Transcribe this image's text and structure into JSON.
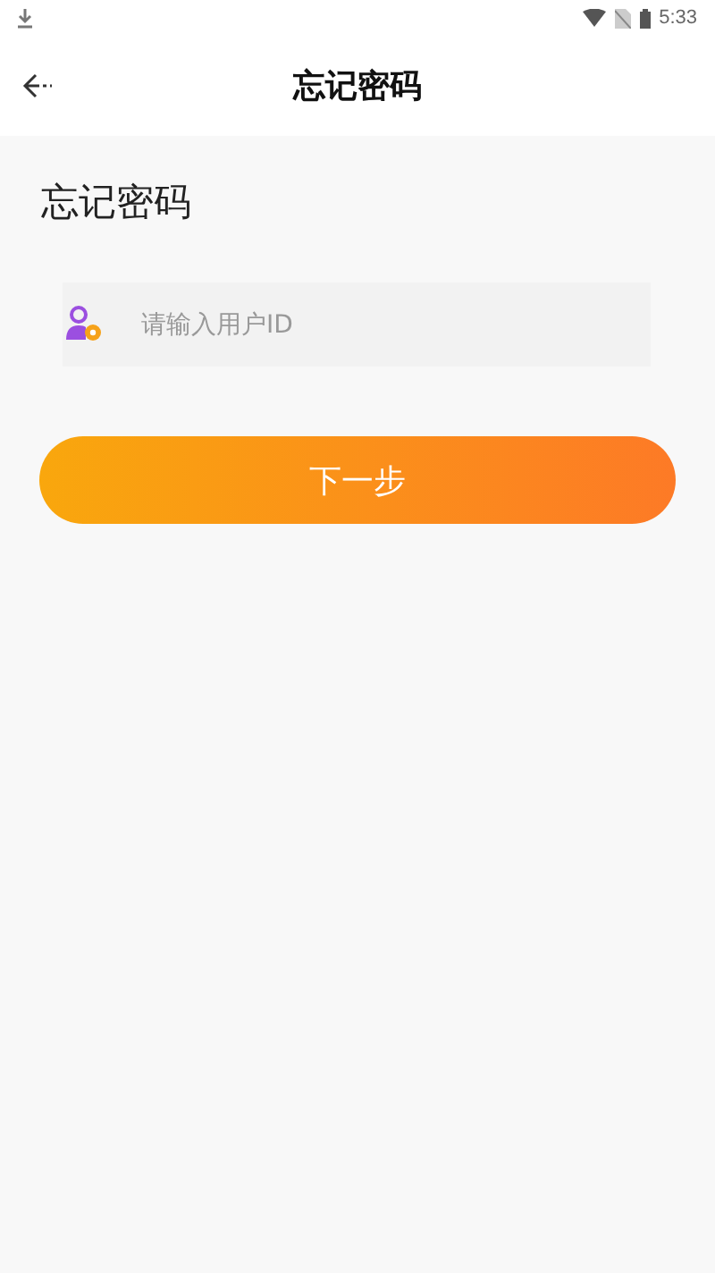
{
  "status_bar": {
    "time": "5:33"
  },
  "header": {
    "title": "忘记密码"
  },
  "heading": "忘记密码",
  "user_id_field": {
    "placeholder": "请输入用户ID"
  },
  "next_button": {
    "label": "下一步"
  }
}
